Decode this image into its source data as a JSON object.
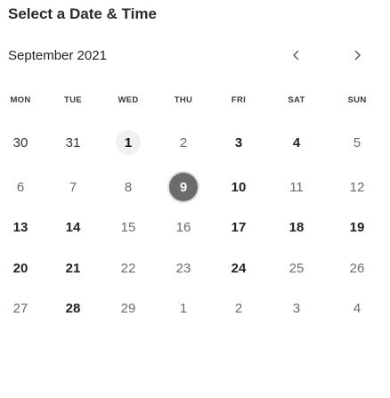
{
  "header": {
    "title": "Select a Date & Time"
  },
  "calendar": {
    "month_label": "September 2021",
    "nav": {
      "prev_glyph": "‹",
      "next_glyph": "›"
    },
    "weekdays": [
      "MON",
      "TUE",
      "WED",
      "THU",
      "FRI",
      "SAT",
      "SUN"
    ],
    "weeks": [
      [
        {
          "label": "30",
          "state": "outside"
        },
        {
          "label": "31",
          "state": "outside"
        },
        {
          "label": "1",
          "state": "current"
        },
        {
          "label": "2",
          "state": "muted"
        },
        {
          "label": "3",
          "state": "active"
        },
        {
          "label": "4",
          "state": "active"
        },
        {
          "label": "5",
          "state": "muted"
        }
      ],
      [
        {
          "label": "6",
          "state": "muted"
        },
        {
          "label": "7",
          "state": "muted"
        },
        {
          "label": "8",
          "state": "muted"
        },
        {
          "label": "9",
          "state": "selected"
        },
        {
          "label": "10",
          "state": "active"
        },
        {
          "label": "11",
          "state": "muted"
        },
        {
          "label": "12",
          "state": "muted"
        }
      ],
      [
        {
          "label": "13",
          "state": "active"
        },
        {
          "label": "14",
          "state": "active"
        },
        {
          "label": "15",
          "state": "muted"
        },
        {
          "label": "16",
          "state": "muted"
        },
        {
          "label": "17",
          "state": "active"
        },
        {
          "label": "18",
          "state": "active"
        },
        {
          "label": "19",
          "state": "active"
        }
      ],
      [
        {
          "label": "20",
          "state": "active"
        },
        {
          "label": "21",
          "state": "active"
        },
        {
          "label": "22",
          "state": "muted"
        },
        {
          "label": "23",
          "state": "muted"
        },
        {
          "label": "24",
          "state": "active"
        },
        {
          "label": "25",
          "state": "muted"
        },
        {
          "label": "26",
          "state": "muted"
        }
      ],
      [
        {
          "label": "27",
          "state": "muted"
        },
        {
          "label": "28",
          "state": "active"
        },
        {
          "label": "29",
          "state": "muted"
        },
        {
          "label": "1",
          "state": "muted"
        },
        {
          "label": "2",
          "state": "muted"
        },
        {
          "label": "3",
          "state": "muted"
        },
        {
          "label": "4",
          "state": "muted"
        }
      ]
    ]
  },
  "colors": {
    "selected_bg": "#6b6b6b",
    "current_bg": "#f0f0f0",
    "text_active": "#222222",
    "text_muted": "#6a6a6a"
  }
}
